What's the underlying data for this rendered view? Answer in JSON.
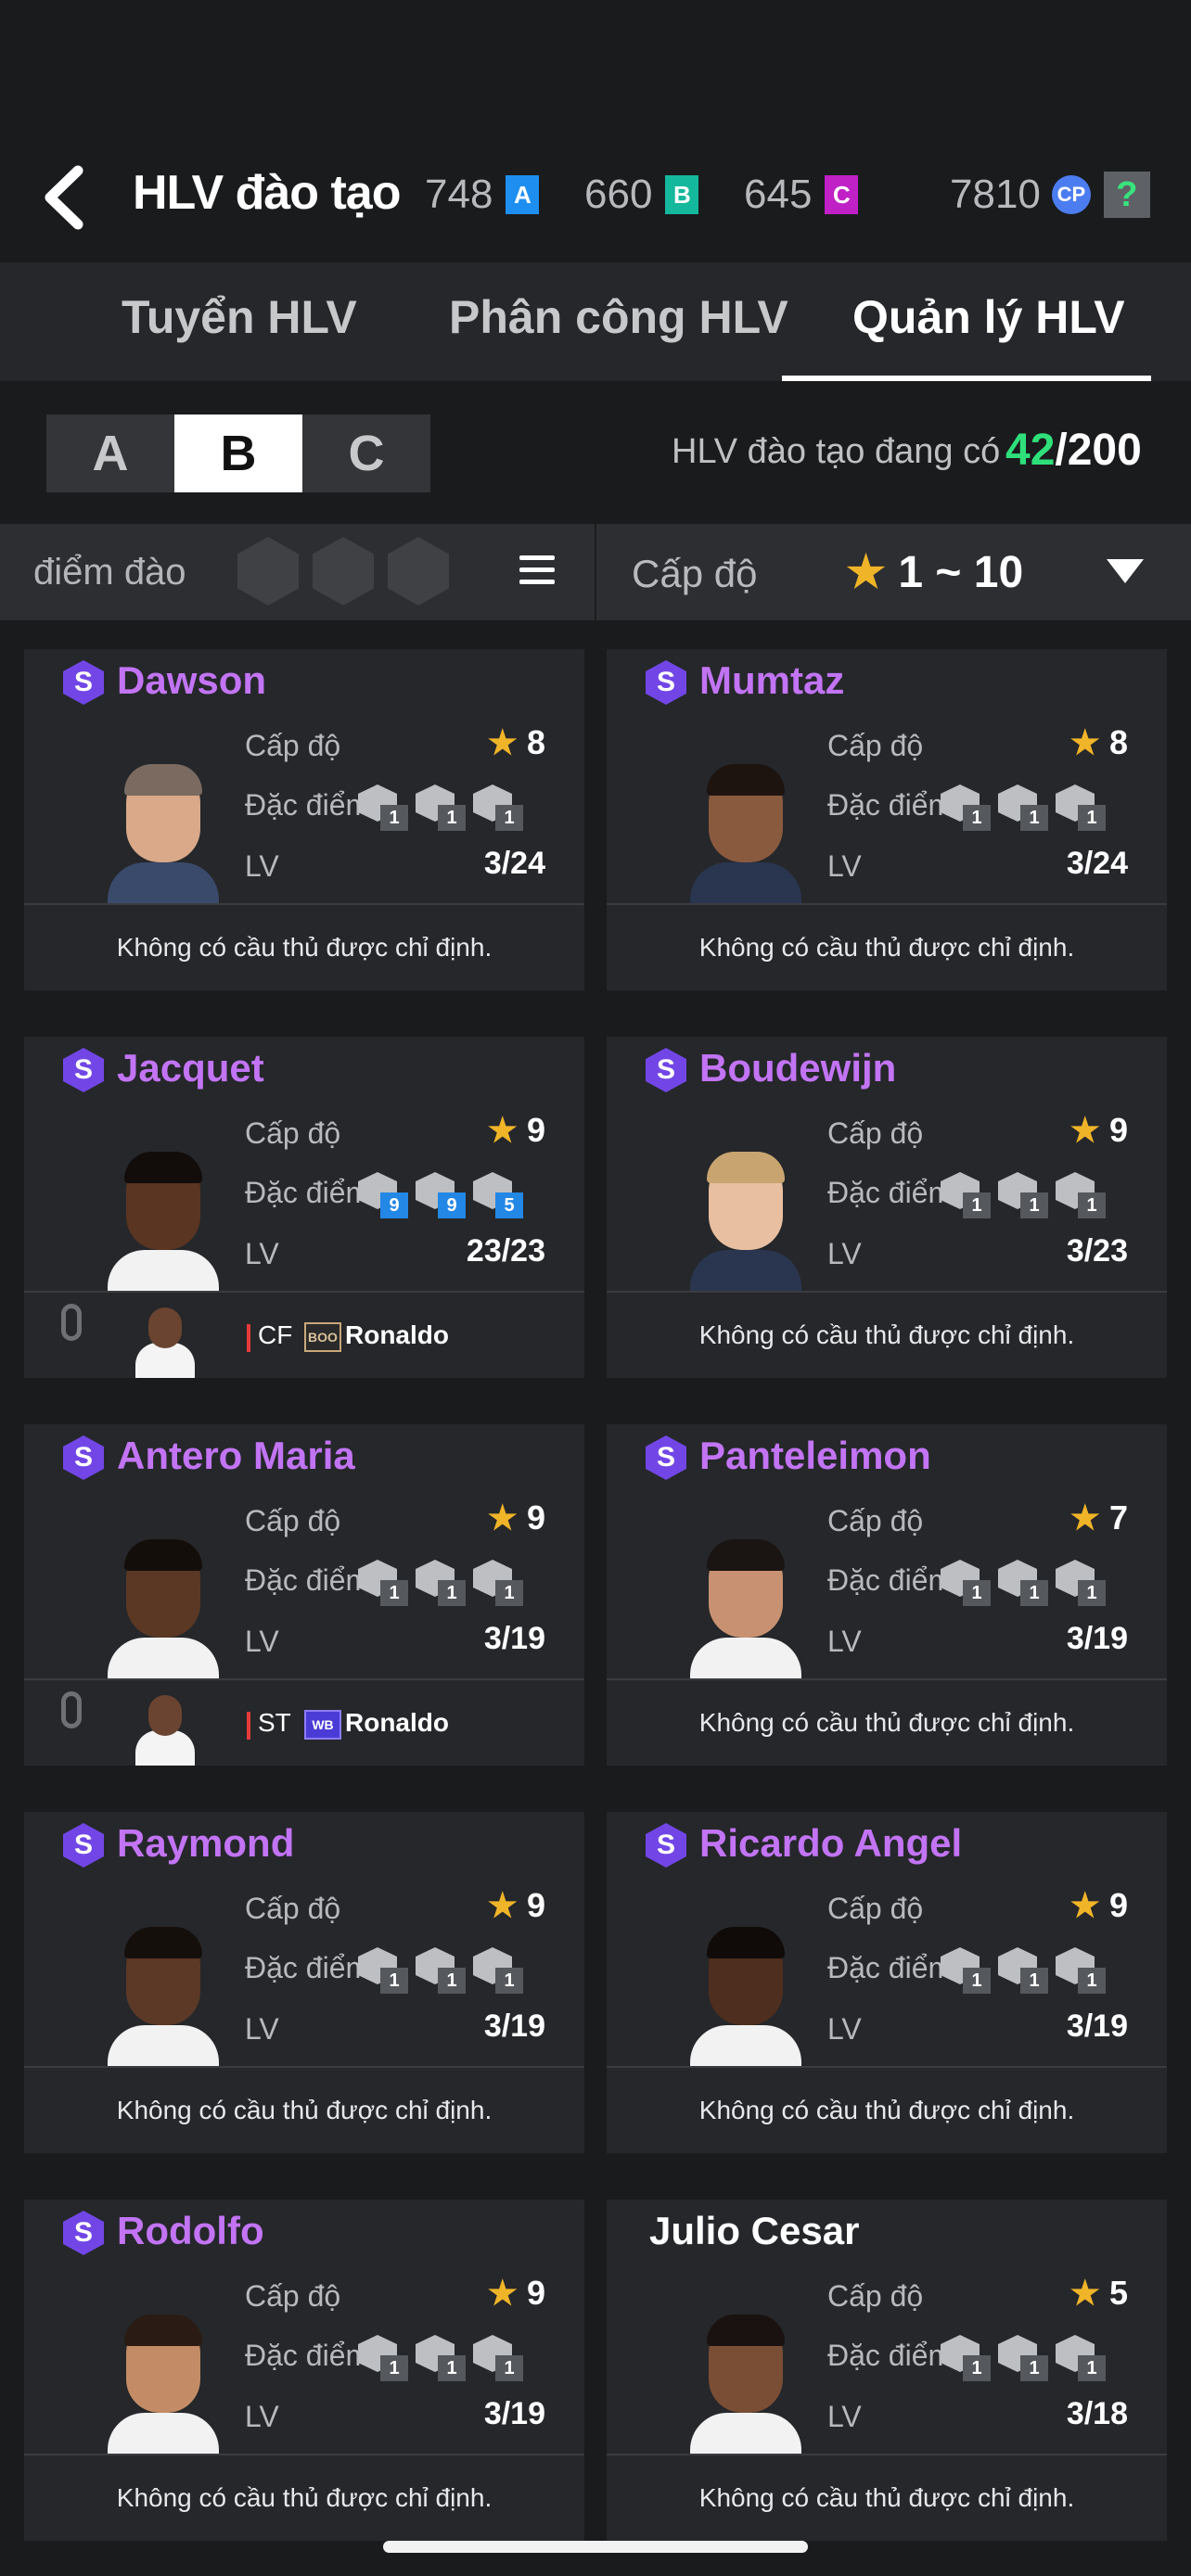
{
  "header": {
    "title": "HLV đào tạo",
    "currencies": [
      {
        "value": "748",
        "badge": "A",
        "color": "#1e8ff0"
      },
      {
        "value": "660",
        "badge": "B",
        "color": "#14b89c"
      },
      {
        "value": "645",
        "badge": "C",
        "color": "#c021c6"
      }
    ],
    "cp_value": "7810",
    "cp_label": "CP",
    "help_label": "?"
  },
  "tabs": [
    "Tuyển HLV",
    "Phân công HLV",
    "Quản lý HLV"
  ],
  "active_tab": 2,
  "segments": [
    "A",
    "B",
    "C"
  ],
  "active_segment": 1,
  "coach_count": {
    "label": "HLV đào tạo đang có",
    "current": "42",
    "max": "/200"
  },
  "filter": {
    "points_label": "điểm đào t",
    "level_label": "Cấp độ",
    "star": "★",
    "level_range": "1 ~ 10"
  },
  "labels": {
    "level": "Cấp độ",
    "trait": "Đặc điểm",
    "lv": "LV",
    "no_player": "Không có cầu thủ được chỉ định.",
    "s_badge": "S"
  },
  "coaches": [
    {
      "name": "Dawson",
      "rank": "S",
      "level": "8",
      "traits": [
        "1",
        "1",
        "1"
      ],
      "lv": "3/24",
      "assigned": null
    },
    {
      "name": "Mumtaz",
      "rank": "S",
      "level": "8",
      "traits": [
        "1",
        "1",
        "1"
      ],
      "lv": "3/24",
      "assigned": null
    },
    {
      "name": "Jacquet",
      "rank": "S",
      "level": "9",
      "traits": [
        "9",
        "9",
        "5"
      ],
      "traits_highlight": true,
      "lv": "23/23",
      "assigned": {
        "position": "CF",
        "tag": "BOO",
        "player": "Ronaldo"
      }
    },
    {
      "name": "Boudewijn",
      "rank": "S",
      "level": "9",
      "traits": [
        "1",
        "1",
        "1"
      ],
      "lv": "3/23",
      "assigned": null
    },
    {
      "name": "Antero Maria",
      "rank": "S",
      "level": "9",
      "traits": [
        "1",
        "1",
        "1"
      ],
      "lv": "3/19",
      "assigned": {
        "position": "ST",
        "tag": "WB",
        "player": "Ronaldo"
      }
    },
    {
      "name": "Panteleimon",
      "rank": "S",
      "level": "7",
      "traits": [
        "1",
        "1",
        "1"
      ],
      "lv": "3/19",
      "assigned": null
    },
    {
      "name": "Raymond",
      "rank": "S",
      "level": "9",
      "traits": [
        "1",
        "1",
        "1"
      ],
      "lv": "3/19",
      "assigned": null
    },
    {
      "name": "Ricardo Angel",
      "rank": "S",
      "level": "9",
      "traits": [
        "1",
        "1",
        "1"
      ],
      "lv": "3/19",
      "assigned": null
    },
    {
      "name": "Rodolfo",
      "rank": "S",
      "level": "9",
      "traits": [
        "1",
        "1",
        "1"
      ],
      "lv": "3/19",
      "assigned": null
    },
    {
      "name": "Julio Cesar",
      "rank": "",
      "level": "5",
      "traits": [
        "1",
        "1",
        "1"
      ],
      "lv": "3/18",
      "assigned": null
    }
  ]
}
